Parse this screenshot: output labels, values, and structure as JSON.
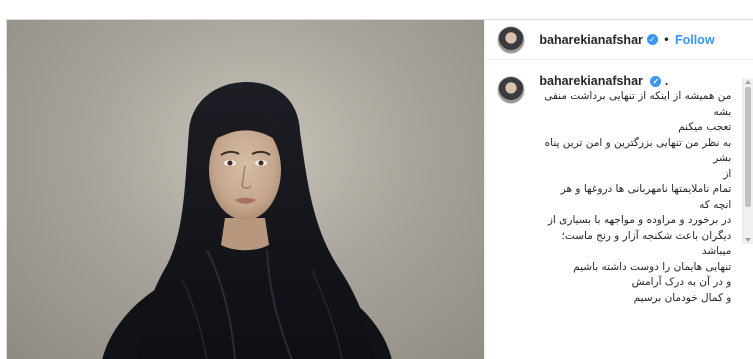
{
  "post": {
    "username": "baharekianafshar",
    "follow_label": "Follow",
    "separator": "•",
    "verified_icon": "✓",
    "caption": {
      "username": "baharekianafshar",
      "suffix": ".",
      "text": "من همیشه از اینکه از تنهایی برداشت منفی بشه\nتعجب میکنم\nبه نظر من تنهایی بزرگترین و امن ترین پناه بشر\nاز\nتمام ناملایمتها نامهربانی ها دروغها و هر انچه که\nدر برخورد و مراوده و مواجهه با بسیاری از\nدیگران باعث شکنجه آزار و رنج ماست؛ میباشد\nتنهایی هایمان را دوست داشته باشیم\nو در آن به درک آرامش\nو کمال خودمان برسیم"
    }
  },
  "colors": {
    "link_blue": "#3897f0",
    "border": "#dbdbdb",
    "scarf": "#15161b"
  }
}
